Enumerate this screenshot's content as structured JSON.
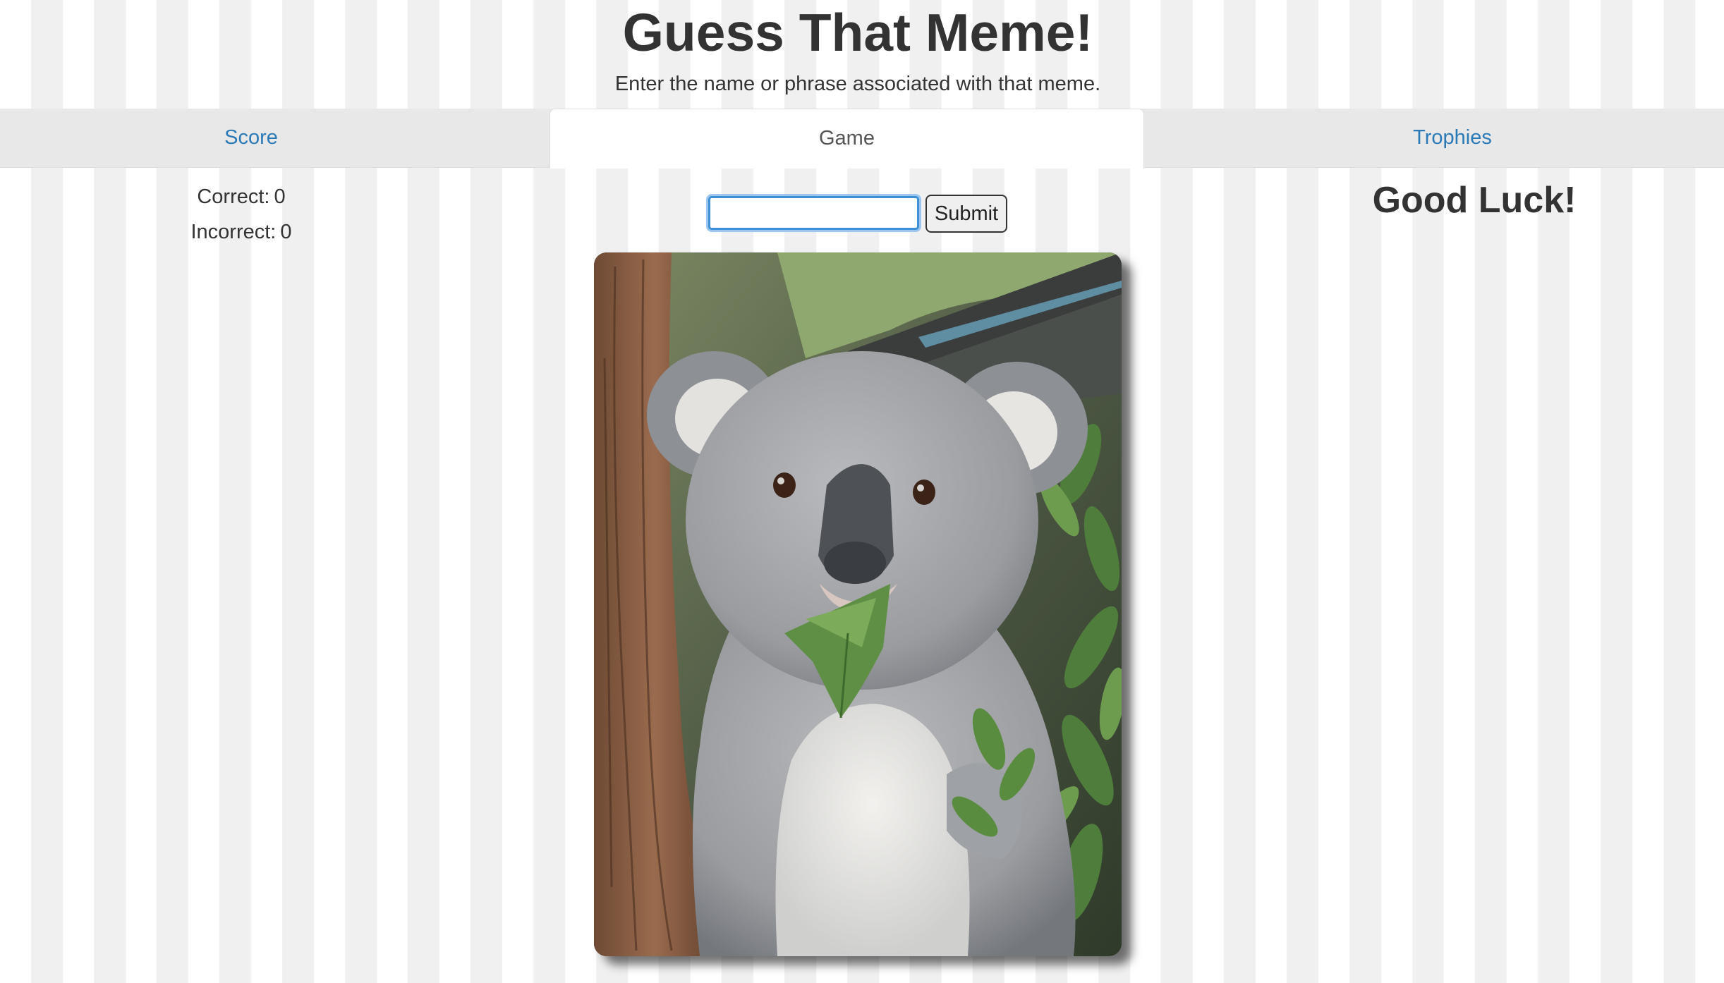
{
  "header": {
    "title": "Guess That Meme!",
    "subtitle": "Enter the name or phrase associated with that meme."
  },
  "tabs": [
    {
      "label": "Score",
      "active": false
    },
    {
      "label": "Game",
      "active": true
    },
    {
      "label": "Trophies",
      "active": false
    }
  ],
  "score": {
    "correct_label": "Correct:",
    "correct_value": "0",
    "incorrect_label": "Incorrect:",
    "incorrect_value": "0"
  },
  "game": {
    "guess_input": {
      "value": "",
      "placeholder": ""
    },
    "submit_label": "Submit",
    "image": {
      "subject": "surprised koala eating eucalyptus leaves",
      "icon": "meme-photo"
    }
  },
  "trophies": {
    "message": "Good Luck!"
  },
  "colors": {
    "link": "#2a7ab8",
    "text": "#333333",
    "tab_bar": "#e8e8e8",
    "stripe": "#f0f0f0",
    "focus": "#3d8fd6"
  }
}
